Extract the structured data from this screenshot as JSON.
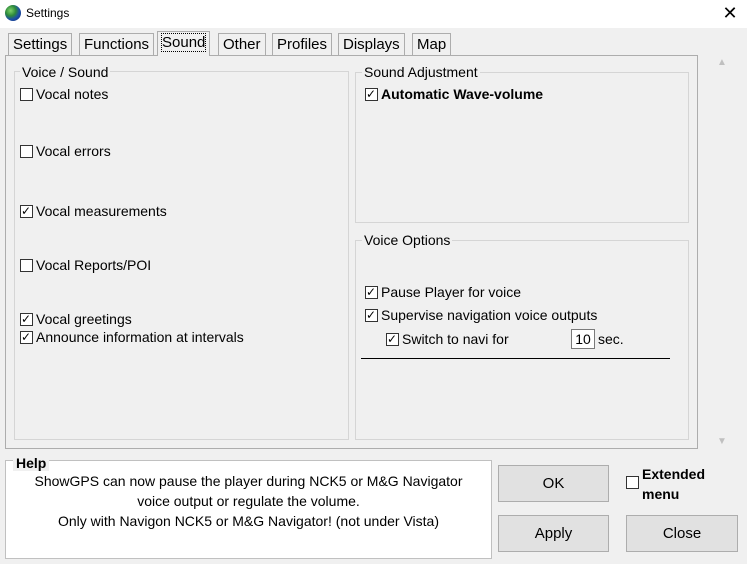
{
  "window": {
    "title": "Settings",
    "icon": "globe-icon",
    "close_glyph": "✕"
  },
  "tabs": [
    {
      "label": "Settings",
      "active": false
    },
    {
      "label": "Functions",
      "active": false
    },
    {
      "label": "Sound",
      "active": true
    },
    {
      "label": "Other",
      "active": false
    },
    {
      "label": "Profiles",
      "active": false
    },
    {
      "label": "Displays",
      "active": false
    },
    {
      "label": "Map",
      "active": false
    }
  ],
  "voice_sound": {
    "title": "Voice / Sound",
    "items": [
      {
        "label": "Vocal notes",
        "checked": false
      },
      {
        "label": "Vocal errors",
        "checked": false
      },
      {
        "label": "Vocal measurements",
        "checked": true
      },
      {
        "label": "Vocal Reports/POI",
        "checked": false
      },
      {
        "label": "Vocal greetings",
        "checked": true
      },
      {
        "label": "Announce information at intervals",
        "checked": true
      }
    ]
  },
  "sound_adjustment": {
    "title": "Sound Adjustment",
    "automatic_wave_volume": {
      "label": "Automatic Wave-volume",
      "checked": true
    }
  },
  "voice_options": {
    "title": "Voice Options",
    "pause_player": {
      "label": "Pause Player for voice",
      "checked": true
    },
    "supervise": {
      "label": "Supervise navigation voice outputs",
      "checked": true
    },
    "switch_to_navi": {
      "label": "Switch to navi for",
      "checked": true
    },
    "seconds_value": "10",
    "seconds_unit": "sec."
  },
  "help": {
    "title": "Help",
    "lines": [
      "ShowGPS can now pause the player during NCK5 or M&G Navigator",
      "voice output or regulate the volume.",
      "Only with Navigon NCK5 or M&G Navigator! (not under Vista)"
    ]
  },
  "buttons": {
    "ok": "OK",
    "apply": "Apply",
    "close": "Close"
  },
  "extended_menu": {
    "label_line1": "Extended",
    "label_line2": "menu",
    "checked": false
  },
  "scroll": {
    "up": "▲",
    "down": "▼"
  }
}
